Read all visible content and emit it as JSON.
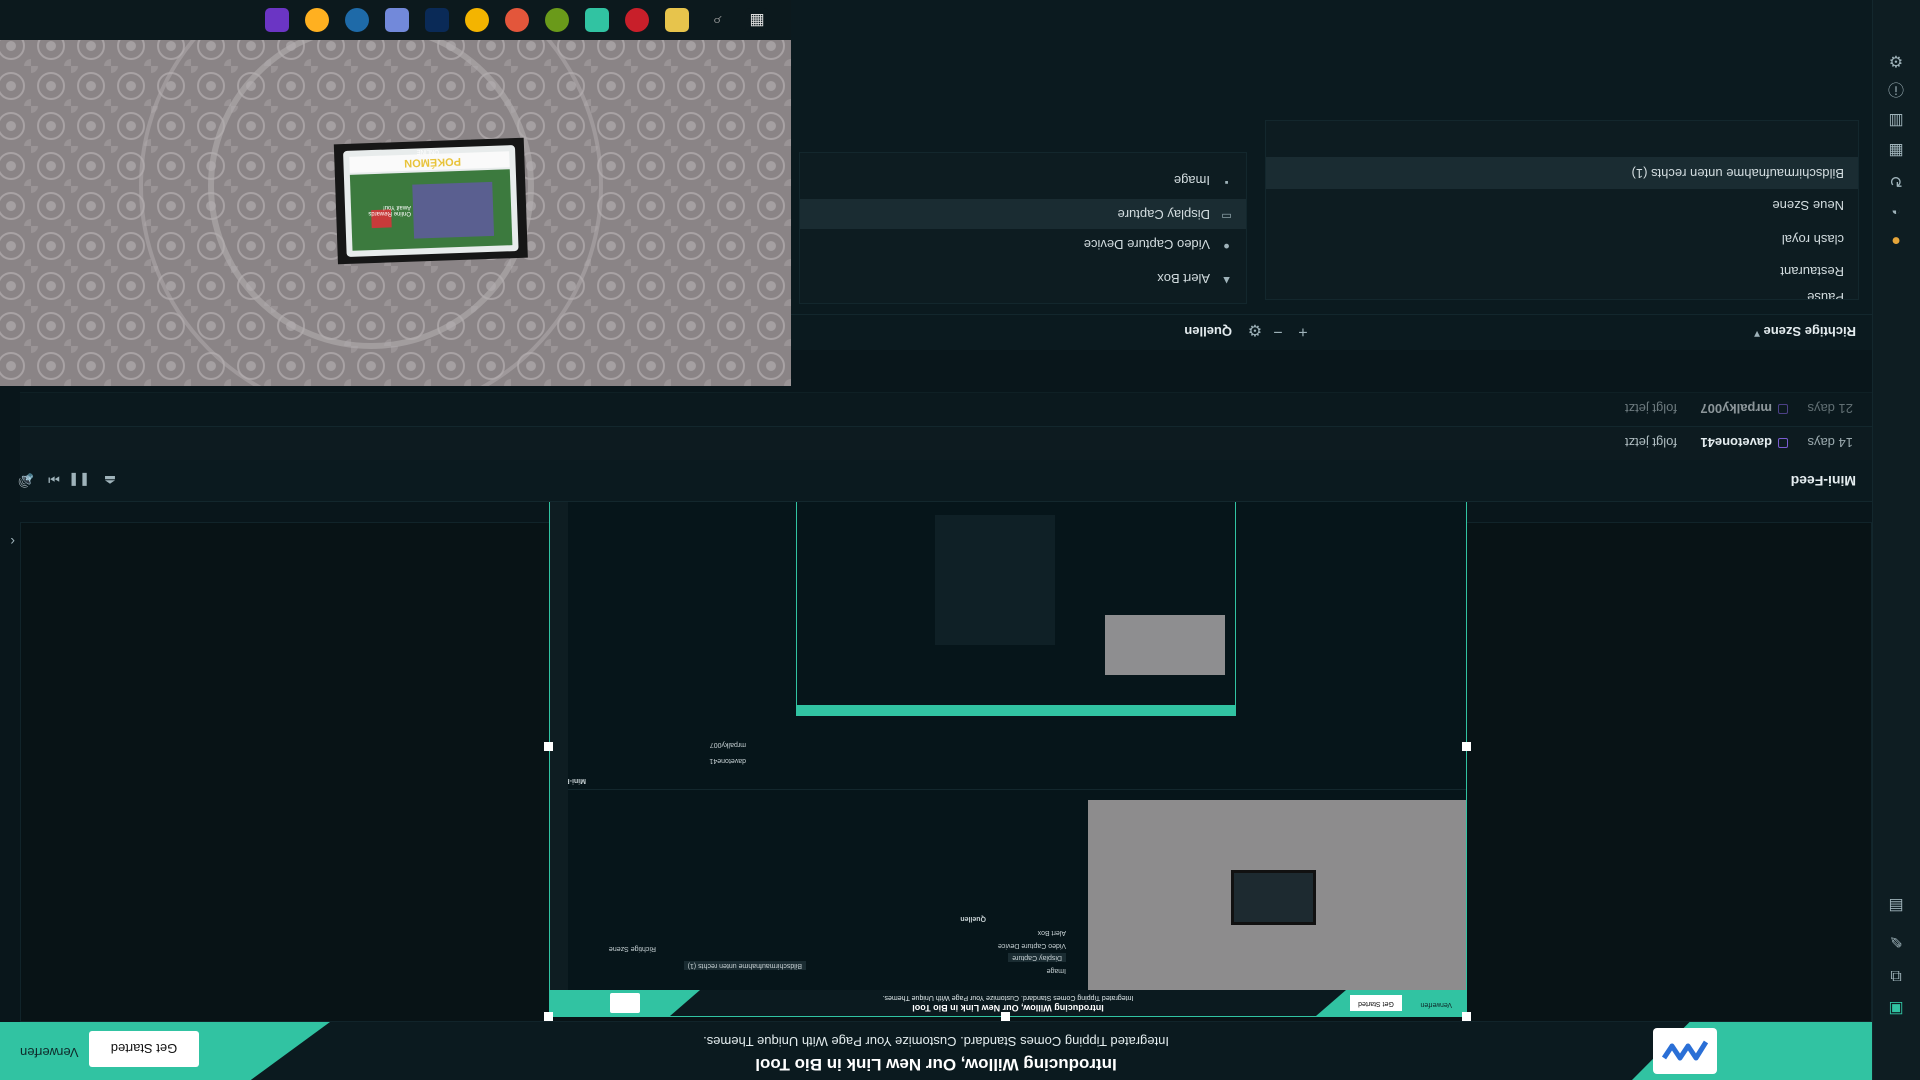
{
  "banner": {
    "headline": "Introducing Willow, Our New Link in Bio Tool",
    "subline": "Integrated Tipping Comes Standard. Customize Your Page With Unique Themes.",
    "get_started": "Get Started",
    "dismiss": "Verwerfen"
  },
  "mini_feed": {
    "title": "Mini-Feed",
    "items": [
      {
        "age": "14 days",
        "user": "davetone41",
        "action": "folgt jetzt"
      },
      {
        "age": "21 days",
        "user": "mrpalky007",
        "action": "folgt jetzt"
      }
    ]
  },
  "scenes": {
    "title": "Richtige Szene",
    "items": [
      "Pause",
      "Restaurant",
      "clash royal",
      "Neue Szene",
      "Bildschirmaufnahme unten rechts (1)"
    ],
    "selected": "Bildschirmaufnahme unten rechts (1)"
  },
  "sources": {
    "title": "Quellen",
    "items": [
      {
        "label": "Alert Box",
        "icon": "bell-icon"
      },
      {
        "label": "Video Capture Device",
        "icon": "camera-icon"
      },
      {
        "label": "Display Capture",
        "icon": "monitor-icon"
      },
      {
        "label": "Image",
        "icon": "image-icon"
      }
    ],
    "selected": "Display Capture"
  },
  "webcam_card": {
    "brand": "POKÉMON",
    "subtitle": "ONLINE",
    "caption": "Online Rewards Await You!"
  },
  "colors": {
    "accent": "#31c3a2",
    "background": "#09161b",
    "panel": "#0d1c21"
  }
}
